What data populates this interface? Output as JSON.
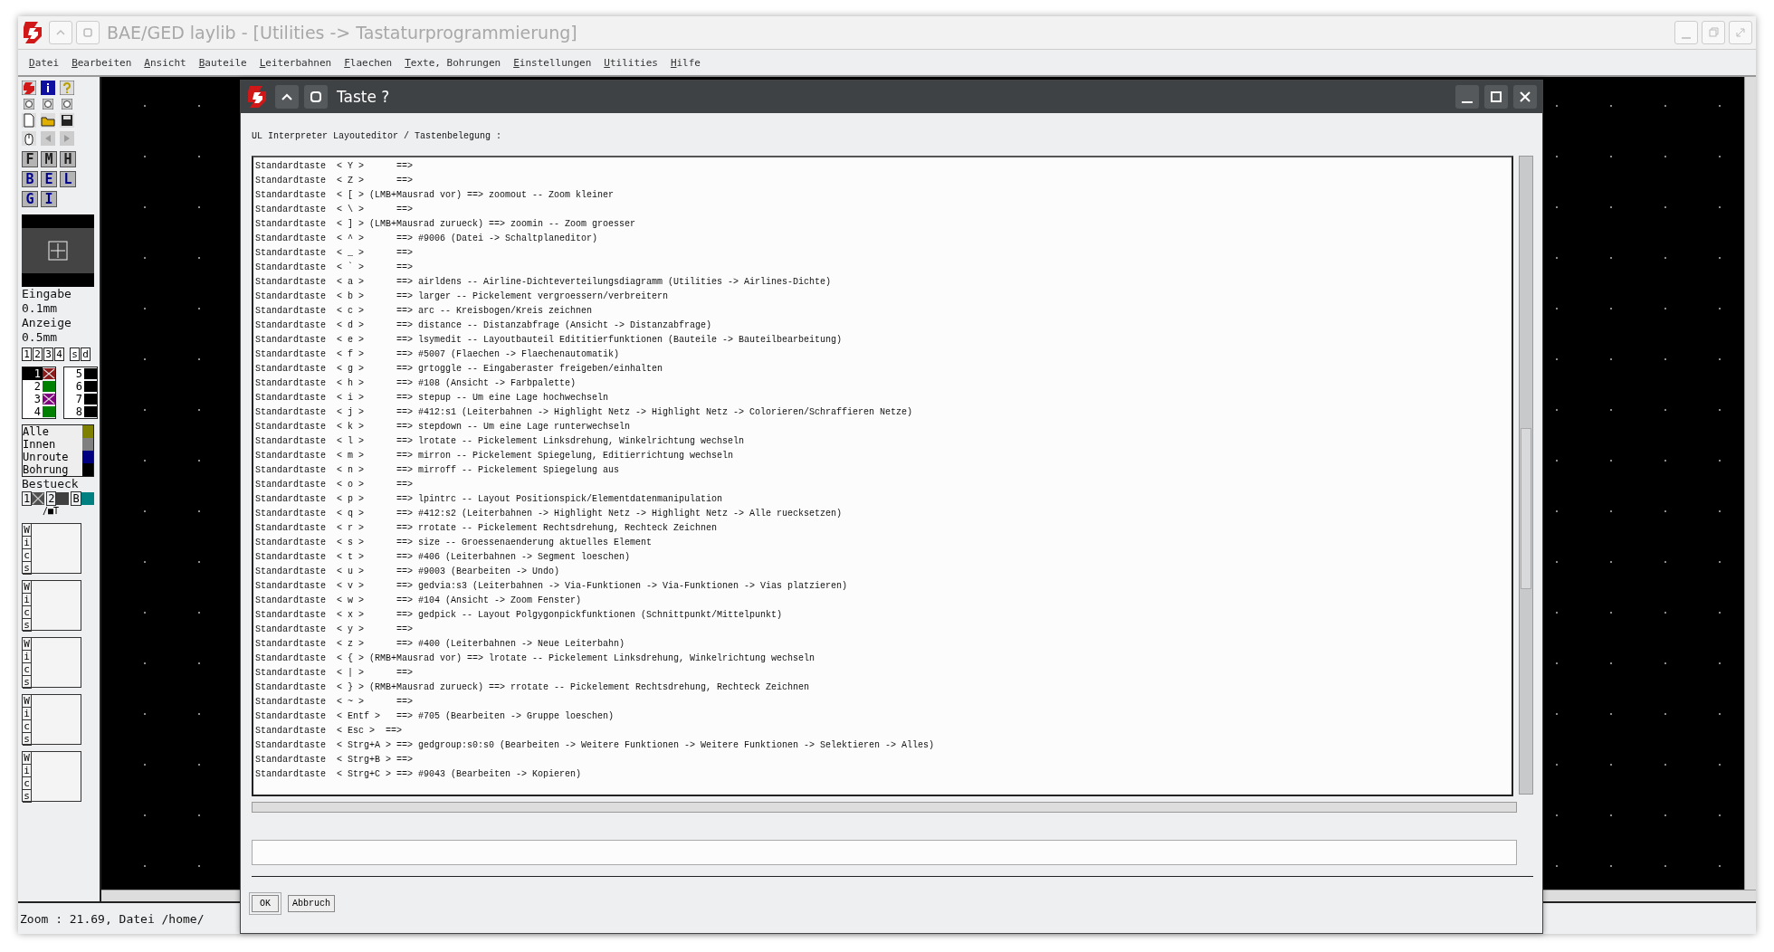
{
  "window": {
    "title": "BAE/GED laylib - [Utilities -> Tastaturprogrammierung]"
  },
  "menu": [
    "Datei",
    "Bearbeiten",
    "Ansicht",
    "Bauteile",
    "Leiterbahnen",
    "Flaechen",
    "Texte, Bohrungen",
    "Einstellungen",
    "Utilities",
    "Hilfe"
  ],
  "tool_letters": [
    {
      "label": "F",
      "color": "#202020"
    },
    {
      "label": "M",
      "color": "#202020"
    },
    {
      "label": "H",
      "color": "#202020"
    },
    {
      "label": "B",
      "color": "#000090"
    },
    {
      "label": "E",
      "color": "#000090"
    },
    {
      "label": "L",
      "color": "#000090"
    },
    {
      "label": "G",
      "color": "#000090"
    },
    {
      "label": "I",
      "color": "#000090"
    }
  ],
  "raster": [
    "Eingabe",
    "0.1mm",
    "Anzeige",
    "0.5mm"
  ],
  "layer_buttons": [
    "1",
    "2",
    "3",
    "4",
    "s",
    "d"
  ],
  "layers": [
    {
      "label": "1",
      "color": "#8b1a1a",
      "selected": true,
      "crossed": true
    },
    {
      "label": "2",
      "color": "#008000",
      "selected": false,
      "crossed": false
    },
    {
      "label": "3",
      "color": "#800080",
      "selected": false,
      "crossed": true
    },
    {
      "label": "4",
      "color": "#008000",
      "selected": false,
      "crossed": false
    },
    {
      "label": "5",
      "color": "#000000",
      "selected": false,
      "crossed": false
    },
    {
      "label": "6",
      "color": "#000000",
      "selected": false,
      "crossed": false
    },
    {
      "label": "7",
      "color": "#000000",
      "selected": false,
      "crossed": false
    },
    {
      "label": "8",
      "color": "#000000",
      "selected": false,
      "crossed": false
    }
  ],
  "display_classes": [
    {
      "label": "Alle",
      "color": "#808000"
    },
    {
      "label": "Innen",
      "color": "#808080"
    },
    {
      "label": "Unroute",
      "color": "#000080"
    },
    {
      "label": "Bohrung",
      "color": "#000000"
    }
  ],
  "placement": {
    "label": "Bestueck",
    "items": [
      {
        "label": "1",
        "color": "#505050",
        "crossed": true
      },
      {
        "label": "2",
        "color": "#404040",
        "crossed": false
      },
      {
        "label": "B",
        "color": "#008080",
        "crossed": false
      }
    ],
    "note": "/■T"
  },
  "macro_slots": [
    {
      "letters": [
        "W",
        "i",
        "c",
        "s"
      ]
    },
    {
      "letters": [
        "W",
        "i",
        "c",
        "s"
      ]
    },
    {
      "letters": [
        "W",
        "i",
        "c",
        "s"
      ]
    },
    {
      "letters": [
        "W",
        "i",
        "c",
        "s"
      ]
    },
    {
      "letters": [
        "W",
        "i",
        "c",
        "s"
      ]
    }
  ],
  "status_bar": "Zoom : 21.69, Datei /home/",
  "dialog": {
    "title": "Taste ?",
    "caption": "UL Interpreter Layouteditor / Tastenbelegung :",
    "lines": [
      "Standardtaste  < Y >      ==>",
      "Standardtaste  < Z >      ==>",
      "Standardtaste  < [ > (LMB+Mausrad vor) ==> zoomout -- Zoom kleiner",
      "Standardtaste  < \\ >      ==>",
      "Standardtaste  < ] > (LMB+Mausrad zurueck) ==> zoomin -- Zoom groesser",
      "Standardtaste  < ^ >      ==> #9006 (Datei -> Schaltplaneditor)",
      "Standardtaste  < _ >      ==>",
      "Standardtaste  < ` >      ==>",
      "Standardtaste  < a >      ==> airldens -- Airline-Dichteverteilungsdiagramm (Utilities -> Airlines-Dichte)",
      "Standardtaste  < b >      ==> larger -- Pickelement vergroessern/verbreitern",
      "Standardtaste  < c >      ==> arc -- Kreisbogen/Kreis zeichnen",
      "Standardtaste  < d >      ==> distance -- Distanzabfrage (Ansicht -> Distanzabfrage)",
      "Standardtaste  < e >      ==> lsymedit -- Layoutbauteil Edititierfunktionen (Bauteile -> Bauteilbearbeitung)",
      "Standardtaste  < f >      ==> #5007 (Flaechen -> Flaechenautomatik)",
      "Standardtaste  < g >      ==> grtoggle -- Eingaberaster freigeben/einhalten",
      "Standardtaste  < h >      ==> #108 (Ansicht -> Farbpalette)",
      "Standardtaste  < i >      ==> stepup -- Um eine Lage hochwechseln",
      "Standardtaste  < j >      ==> #412:s1 (Leiterbahnen -> Highlight Netz -> Highlight Netz -> Colorieren/Schraffieren Netze)",
      "Standardtaste  < k >      ==> stepdown -- Um eine Lage runterwechseln",
      "Standardtaste  < l >      ==> lrotate -- Pickelement Linksdrehung, Winkelrichtung wechseln",
      "Standardtaste  < m >      ==> mirron -- Pickelement Spiegelung, Editierrichtung wechseln",
      "Standardtaste  < n >      ==> mirroff -- Pickelement Spiegelung aus",
      "Standardtaste  < o >      ==>",
      "Standardtaste  < p >      ==> lpintrc -- Layout Positionspick/Elementdatenmanipulation",
      "Standardtaste  < q >      ==> #412:s2 (Leiterbahnen -> Highlight Netz -> Highlight Netz -> Alle ruecksetzen)",
      "Standardtaste  < r >      ==> rrotate -- Pickelement Rechtsdrehung, Rechteck Zeichnen",
      "Standardtaste  < s >      ==> size -- Groessenaenderung aktuelles Element",
      "Standardtaste  < t >      ==> #406 (Leiterbahnen -> Segment loeschen)",
      "Standardtaste  < u >      ==> #9003 (Bearbeiten -> Undo)",
      "Standardtaste  < v >      ==> gedvia:s3 (Leiterbahnen -> Via-Funktionen -> Via-Funktionen -> Vias platzieren)",
      "Standardtaste  < w >      ==> #104 (Ansicht -> Zoom Fenster)",
      "Standardtaste  < x >      ==> gedpick -- Layout Polgygonpickfunktionen (Schnittpunkt/Mittelpunkt)",
      "Standardtaste  < y >      ==>",
      "Standardtaste  < z >      ==> #400 (Leiterbahnen -> Neue Leiterbahn)",
      "Standardtaste  < { > (RMB+Mausrad vor) ==> lrotate -- Pickelement Linksdrehung, Winkelrichtung wechseln",
      "Standardtaste  < | >      ==>",
      "Standardtaste  < } > (RMB+Mausrad zurueck) ==> rrotate -- Pickelement Rechtsdrehung, Rechteck Zeichnen",
      "Standardtaste  < ~ >      ==>",
      "Standardtaste  < Entf >   ==> #705 (Bearbeiten -> Gruppe loeschen)",
      "Standardtaste  < Esc >  ==>",
      "Standardtaste  < Strg+A > ==> gedgroup:s0:s0 (Bearbeiten -> Weitere Funktionen -> Weitere Funktionen -> Selektieren -> Alles)",
      "Standardtaste  < Strg+B > ==>",
      "Standardtaste  < Strg+C > ==> #9043 (Bearbeiten -> Kopieren)"
    ],
    "buttons": [
      "OK",
      "Abbruch"
    ]
  }
}
